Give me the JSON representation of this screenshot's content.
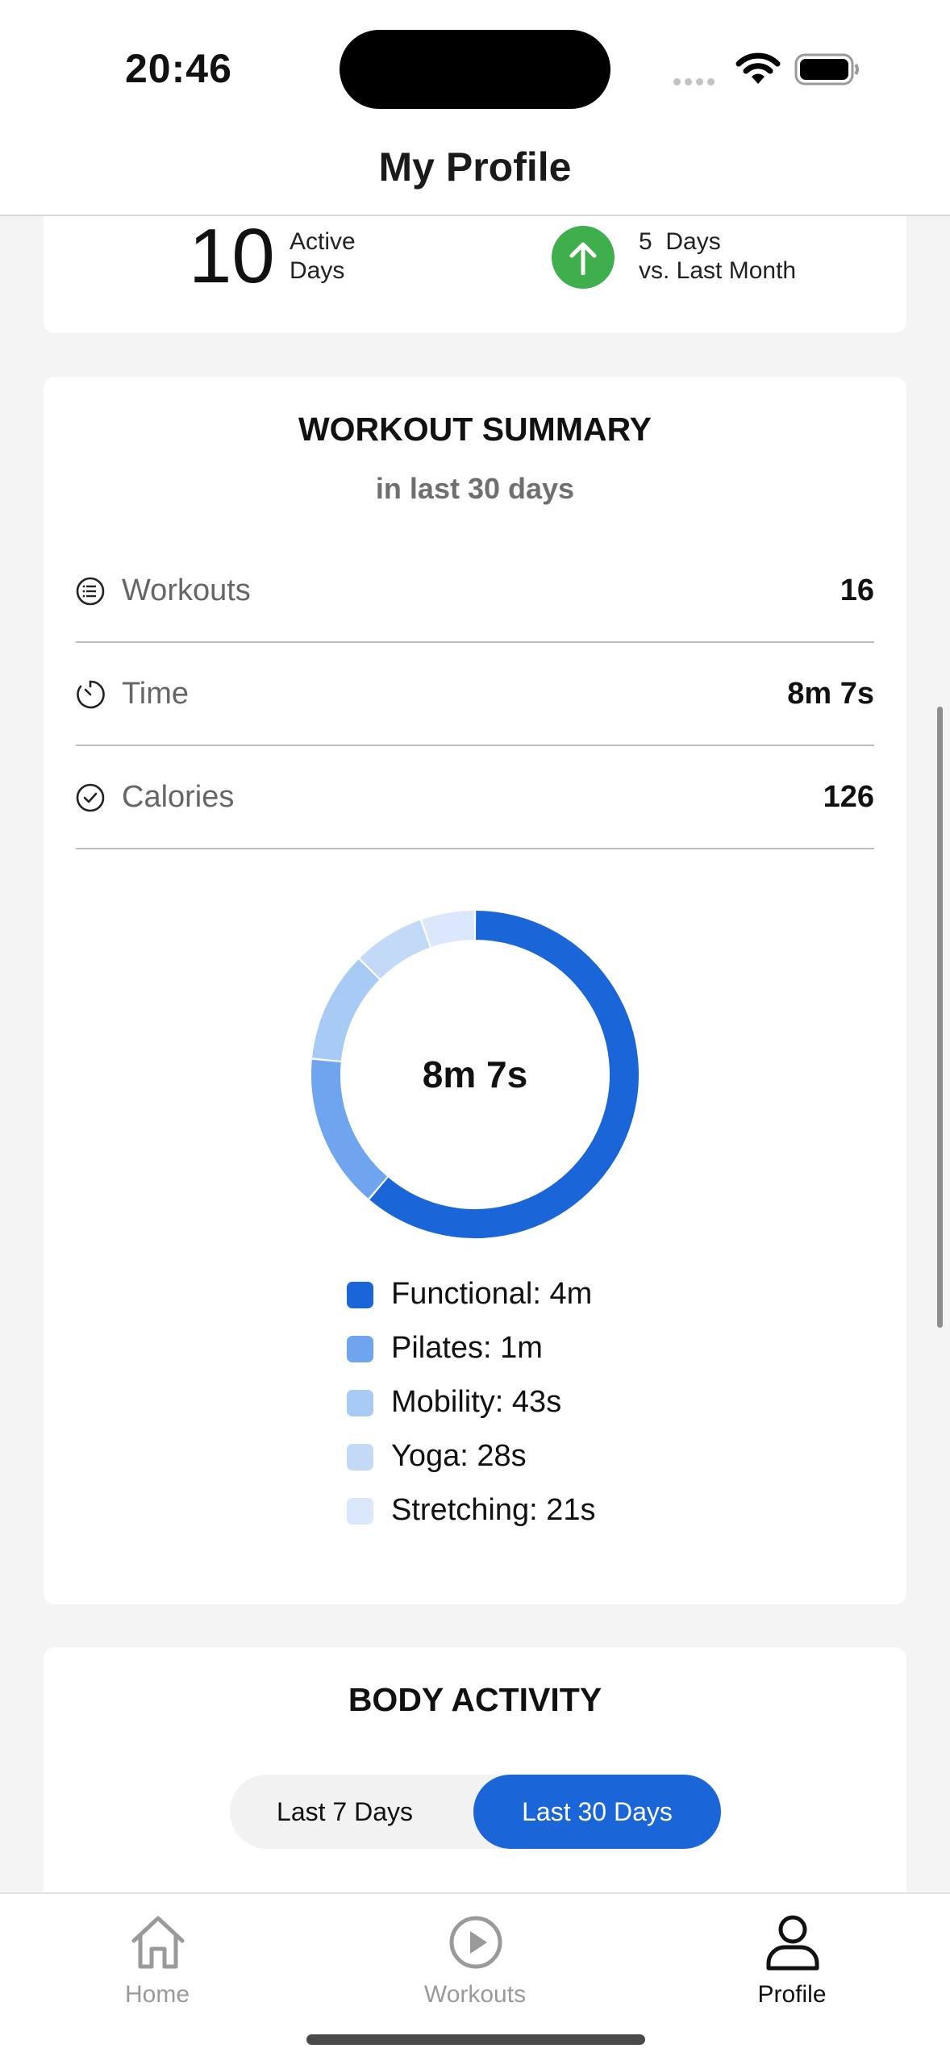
{
  "status_bar": {
    "time": "20:46"
  },
  "header": {
    "title": "My Profile"
  },
  "active_days": {
    "count": "10",
    "label_line1": "Active",
    "label_line2": "Days",
    "delta_line1": "5  Days",
    "delta_line2": "vs. Last Month",
    "trend_color": "#3fae4c"
  },
  "workout_summary": {
    "title": "WORKOUT SUMMARY",
    "subtitle": "in last 30 days",
    "stats": [
      {
        "icon": "list-icon",
        "label": "Workouts",
        "value": "16"
      },
      {
        "icon": "timer-icon",
        "label": "Time",
        "value": "8m 7s"
      },
      {
        "icon": "check-circle-icon",
        "label": "Calories",
        "value": "126"
      }
    ],
    "donut_center": "8m 7s",
    "legend": [
      "Functional: 4m",
      "Pilates: 1m",
      "Mobility: 43s",
      "Yoga: 28s",
      "Stretching: 21s"
    ]
  },
  "chart_data": {
    "type": "pie",
    "title": "",
    "categories": [
      "Functional",
      "Pilates",
      "Mobility",
      "Yoga",
      "Stretching"
    ],
    "values": [
      240,
      60,
      43,
      28,
      21
    ],
    "colors": [
      "#1a66d9",
      "#6fa5ef",
      "#a8cbf6",
      "#c2daf8",
      "#dbe8fb"
    ],
    "center_label": "8m 7s"
  },
  "body_activity": {
    "title": "BODY ACTIVITY",
    "range_options": [
      "Last 7 Days",
      "Last 30 Days"
    ],
    "selected": "Last 30 Days"
  },
  "tab_bar": {
    "tabs": [
      {
        "label": "Home",
        "icon": "home-icon"
      },
      {
        "label": "Workouts",
        "icon": "play-circle-icon"
      },
      {
        "label": "Profile",
        "icon": "person-icon"
      }
    ],
    "active": "Profile"
  },
  "colors": {
    "accent": "#1a66d9",
    "background": "#f4f4f4"
  }
}
